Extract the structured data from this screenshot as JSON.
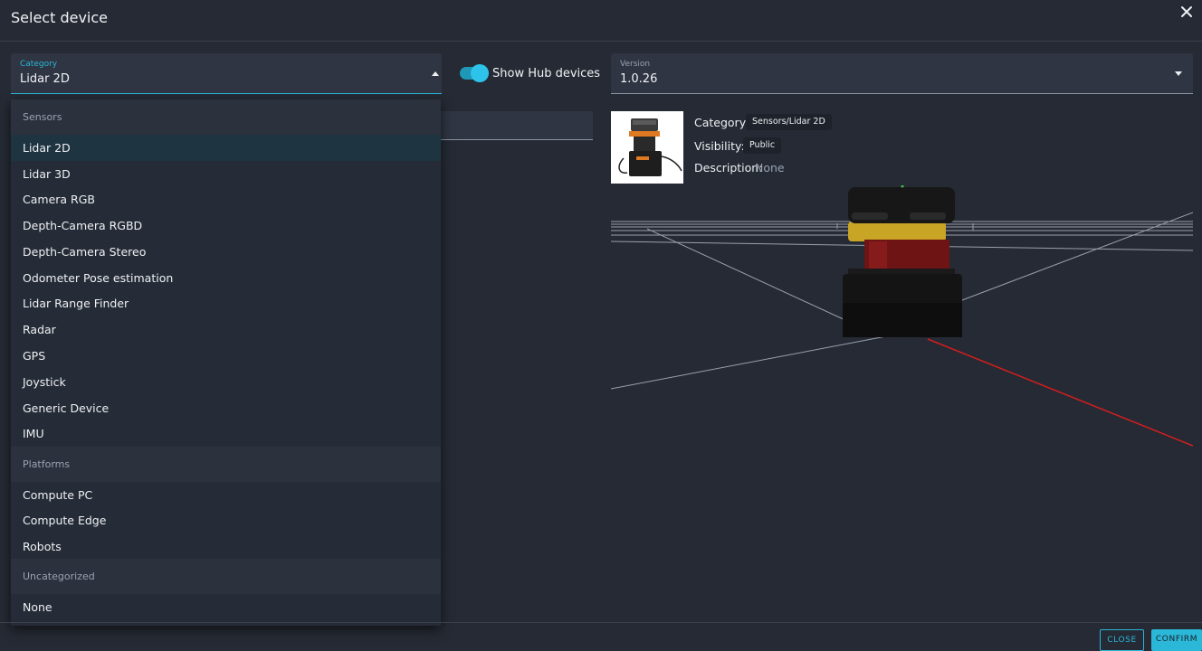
{
  "dialog": {
    "title": "Select device"
  },
  "category_field": {
    "label": "Category",
    "value": "Lidar 2D"
  },
  "hub_toggle": {
    "label": "Show Hub devices",
    "on": true
  },
  "version_field": {
    "label": "Version",
    "value": "1.0.26"
  },
  "dropdown": {
    "groups": [
      {
        "header": "Sensors",
        "items": [
          "Lidar 2D",
          "Lidar 3D",
          "Camera RGB",
          "Depth-Camera RGBD",
          "Depth-Camera Stereo",
          "Odometer Pose estimation",
          "Lidar Range Finder",
          "Radar",
          "GPS",
          "Joystick",
          "Generic Device",
          "IMU"
        ]
      },
      {
        "header": "Platforms",
        "items": [
          "Compute PC",
          "Compute Edge",
          "Robots"
        ]
      },
      {
        "header": "Uncategorized",
        "items": [
          "None"
        ]
      }
    ],
    "selected": "Lidar 2D"
  },
  "device_info": {
    "category_label": "Category:",
    "category_value": "Sensors/Lidar 2D",
    "visibility_label": "Visibility:",
    "visibility_value": "Public",
    "description_label": "Description:",
    "description_value": "None"
  },
  "footer": {
    "close_label": "CLOSE",
    "confirm_label": "CONFIRM"
  },
  "colors": {
    "accent": "#2bb7d8",
    "background": "#252a34",
    "panel": "#2f3542",
    "axis_x": "#d41e1e"
  },
  "icons": {
    "close": "close-icon",
    "caret_up": "caret-up-icon",
    "caret_down": "caret-down-icon"
  }
}
